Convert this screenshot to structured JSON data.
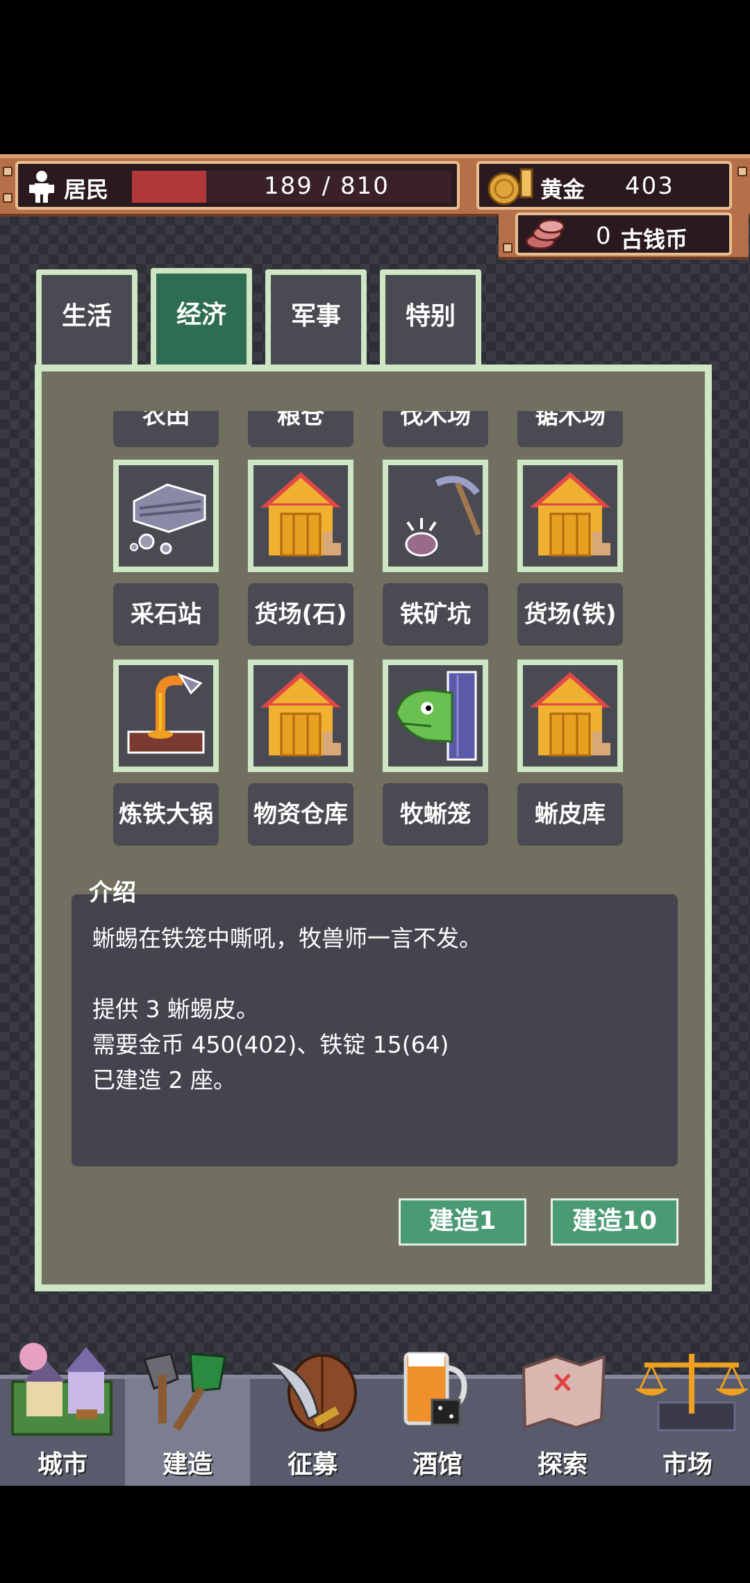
{
  "resources": {
    "residents_label": "居民",
    "residents_value": "189 / 810",
    "residents_progress": 0.233,
    "gold_label": "黄金",
    "gold_value": "403",
    "coin_value": "0",
    "coin_label": "古钱币"
  },
  "tabs": [
    {
      "label": "生活"
    },
    {
      "label": "经济"
    },
    {
      "label": "军事"
    },
    {
      "label": "特别"
    }
  ],
  "active_tab": "经济",
  "buildings_partial_row": [
    "农田",
    "粮仓",
    "伐木场",
    "锯木场"
  ],
  "buildings": [
    {
      "label": "采石站",
      "icon": "stone-pile-icon"
    },
    {
      "label": "货场(石)",
      "icon": "warehouse-icon"
    },
    {
      "label": "铁矿坑",
      "icon": "pickaxe-ore-icon"
    },
    {
      "label": "货场(铁)",
      "icon": "warehouse-icon"
    },
    {
      "label": "炼铁大锅",
      "icon": "smelter-icon"
    },
    {
      "label": "物资仓库",
      "icon": "warehouse-icon"
    },
    {
      "label": "牧蜥笼",
      "icon": "lizard-cage-icon"
    },
    {
      "label": "蜥皮库",
      "icon": "warehouse-icon"
    }
  ],
  "description": {
    "title": "介绍",
    "line1": "蜥蜴在铁笼中嘶吼，牧兽师一言不发。",
    "line2": "提供 3 蜥蜴皮。",
    "line3": "需要金币 450(402)、铁锭 15(64)",
    "line4": "已建造 2 座。"
  },
  "actions": {
    "build1": "建造1",
    "build10": "建造10"
  },
  "nav": [
    {
      "label": "城市",
      "icon": "city-icon"
    },
    {
      "label": "建造",
      "icon": "shovel-icon"
    },
    {
      "label": "征募",
      "icon": "sword-shield-icon"
    },
    {
      "label": "酒馆",
      "icon": "beer-mug-icon"
    },
    {
      "label": "探索",
      "icon": "map-icon"
    },
    {
      "label": "市场",
      "icon": "scales-icon"
    }
  ],
  "colors": {
    "accent_green": "#4a9a74",
    "active_tab": "#2f6d52",
    "panel_border": "#cfe6c4",
    "resident_bar": "#b03a3a"
  }
}
